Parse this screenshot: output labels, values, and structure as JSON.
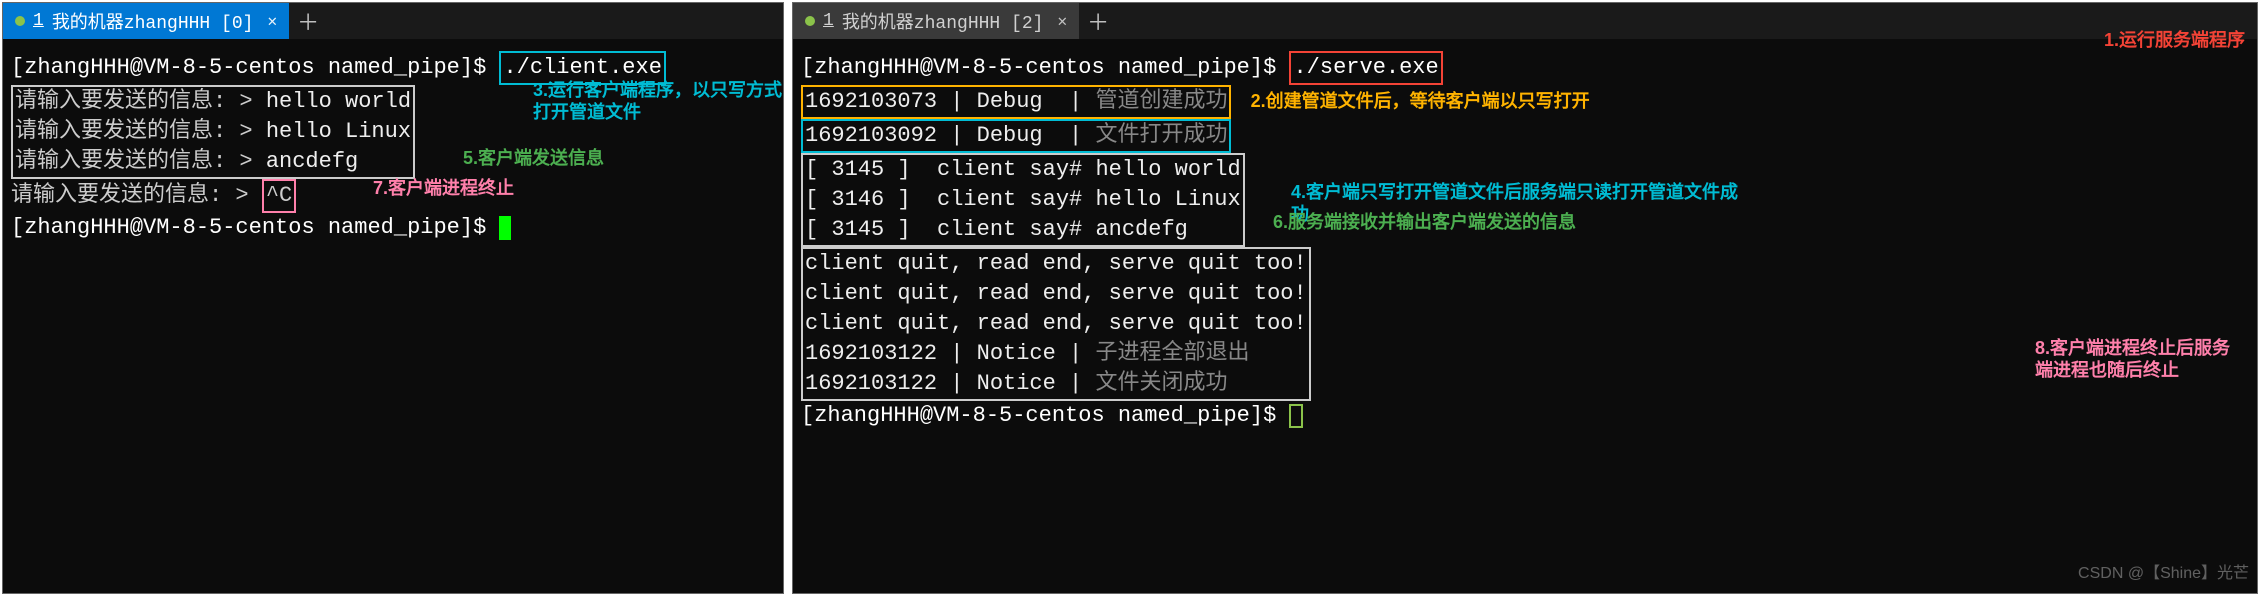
{
  "left": {
    "tab_title": "我的机器zhangHHH [0]",
    "tab_num": "1",
    "prompt": "[zhangHHH@VM-8-5-centos named_pipe]$ ",
    "cmd": "./client.exe",
    "input_label": "请输入要发送的信息: > ",
    "inputs": [
      "hello world",
      "hello Linux",
      "ancdefg"
    ],
    "sigint": "^C",
    "ann3": "3.运行客户端程序，以只写方式打开管道文件",
    "ann5": "5.客户端发送信息",
    "ann7": "7.客户端进程终止"
  },
  "right": {
    "tab_title": "我的机器zhangHHH [2]",
    "tab_num": "1",
    "prompt": "[zhangHHH@VM-8-5-centos named_pipe]$ ",
    "cmd": "./serve.exe",
    "debug1": "1692103073 | Debug  | ",
    "debug1msg": "管道创建成功",
    "debug2": "1692103092 | Debug  | ",
    "debug2msg": "文件打开成功",
    "say1": "[ 3145 ]  client say# hello world",
    "say2": "[ 3146 ]  client say# hello Linux",
    "say3": "[ 3145 ]  client say# ancdefg",
    "quit1": "client quit, read end, serve quit too!",
    "quit2": "client quit, read end, serve quit too!",
    "quit3": "client quit, read end, serve quit too!",
    "notice1": "1692103122 | Notice | ",
    "notice1msg": "子进程全部退出",
    "notice2": "1692103122 | Notice | ",
    "notice2msg": "文件关闭成功",
    "ann1": "1.运行服务端程序",
    "ann2": "2.创建管道文件后，等待客户端以只写打开",
    "ann4": "4.客户端只写打开管道文件后服务端只读打开管道文件成功",
    "ann6": "6.服务端接收并输出客户端发送的信息",
    "ann8": "8.客户端进程终止后服务端进程也随后终止"
  },
  "watermark": "CSDN @【Shine】光芒"
}
